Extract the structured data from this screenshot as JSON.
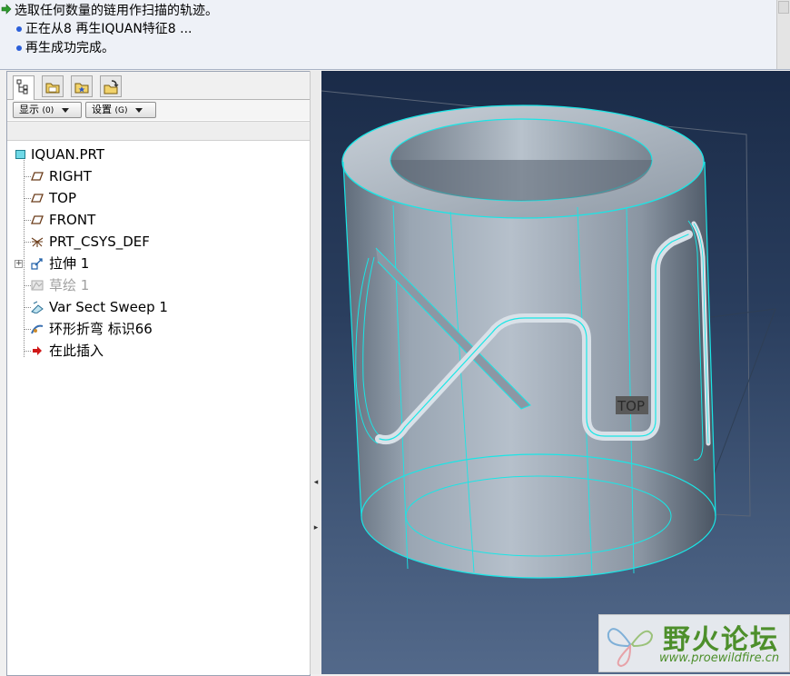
{
  "messages": {
    "line1": "选取任何数量的链用作扫描的轨迹。",
    "line2": "正在从8 再生IQUAN特征8 ...",
    "line3": "再生成功完成。"
  },
  "tabs": [
    {
      "icon": "model-tree-icon"
    },
    {
      "icon": "folder-browser-icon"
    },
    {
      "icon": "favorites-icon"
    },
    {
      "icon": "connections-icon"
    }
  ],
  "toolbar": {
    "show_label": "显示",
    "show_shortcut": "(0)",
    "settings_label": "设置",
    "settings_shortcut": "(G)"
  },
  "tree": {
    "root": "IQUAN.PRT",
    "items": [
      {
        "label": "RIGHT",
        "icon": "datum-plane-icon"
      },
      {
        "label": "TOP",
        "icon": "datum-plane-icon"
      },
      {
        "label": "FRONT",
        "icon": "datum-plane-icon"
      },
      {
        "label": "PRT_CSYS_DEF",
        "icon": "csys-icon"
      },
      {
        "label": "拉伸 1",
        "icon": "extrude-icon"
      },
      {
        "label": "草绘 1",
        "icon": "sketch-icon"
      },
      {
        "label": "Var Sect Sweep 1",
        "icon": "sweep-icon"
      },
      {
        "label": "环形折弯 标识66",
        "icon": "toroidal-bend-icon"
      },
      {
        "label": "在此插入",
        "icon": "insert-here-icon"
      }
    ]
  },
  "viewport": {
    "datum_label": "TOP",
    "background_top": "#1a2b48",
    "background_bottom": "#53698a",
    "edge_color": "#19e6e6"
  },
  "watermark": {
    "title": "野火论坛",
    "url": "www.proewildfire.cn"
  }
}
